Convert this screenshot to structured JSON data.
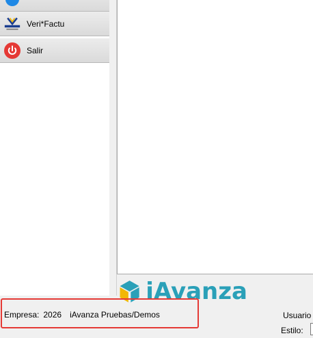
{
  "sidebar": {
    "items": [
      {
        "label": "",
        "icon": "info-icon"
      },
      {
        "label": "Veri*Factu",
        "icon": "verifactu-icon"
      },
      {
        "label": "Salir",
        "icon": "power-icon"
      }
    ]
  },
  "brand": {
    "name": "iAvanza",
    "color": "#2aa0b8"
  },
  "status": {
    "empresa_label": "Empresa:",
    "empresa_code": "2026",
    "empresa_name": "iAvanza Pruebas/Demos",
    "usuario_label": "Usuario",
    "estilo_label": "Estilo:"
  },
  "colors": {
    "highlight": "#e53935",
    "exit_red": "#e53935",
    "info_blue": "#1e88e5"
  }
}
